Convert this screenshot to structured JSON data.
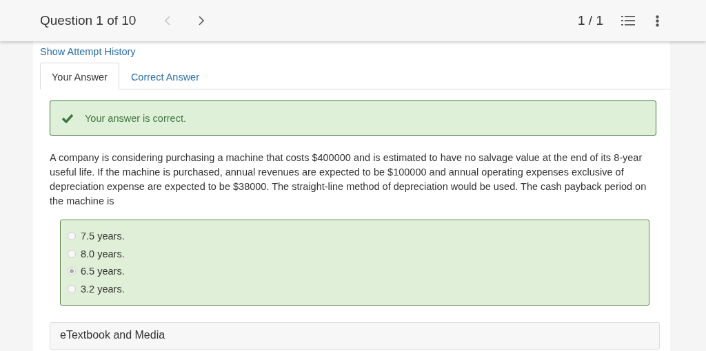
{
  "header": {
    "title": "Question 1 of 10",
    "nav": [
      {
        "kind": "prev",
        "disabled": true
      },
      {
        "kind": "next",
        "disabled": false
      }
    ],
    "page_count": "1 / 1"
  },
  "attempt_link": "Show Attempt History",
  "tabs": [
    {
      "label": "Your Answer",
      "selected": true
    },
    {
      "label": "Correct Answer",
      "selected": false
    }
  ],
  "feedback": {
    "kind": "correct",
    "message": "Your answer is correct."
  },
  "question": "A company is considering purchasing a machine that costs $400000 and is estimated to have no salvage value at the end of its 8-year useful life. If the machine is purchased, annual revenues are expected to be $100000 and annual operating expenses exclusive of depreciation expense are expected to be $38000. The straight-line method of depreciation would be used. The cash payback period on the machine is",
  "choices": [
    {
      "label": "7.5 years.",
      "selected": false
    },
    {
      "label": "8.0 years.",
      "selected": false
    },
    {
      "label": "6.5 years.",
      "selected": true
    },
    {
      "label": "3.2 years.",
      "selected": false
    }
  ],
  "media_panel": {
    "title": "eTextbook and Media"
  }
}
